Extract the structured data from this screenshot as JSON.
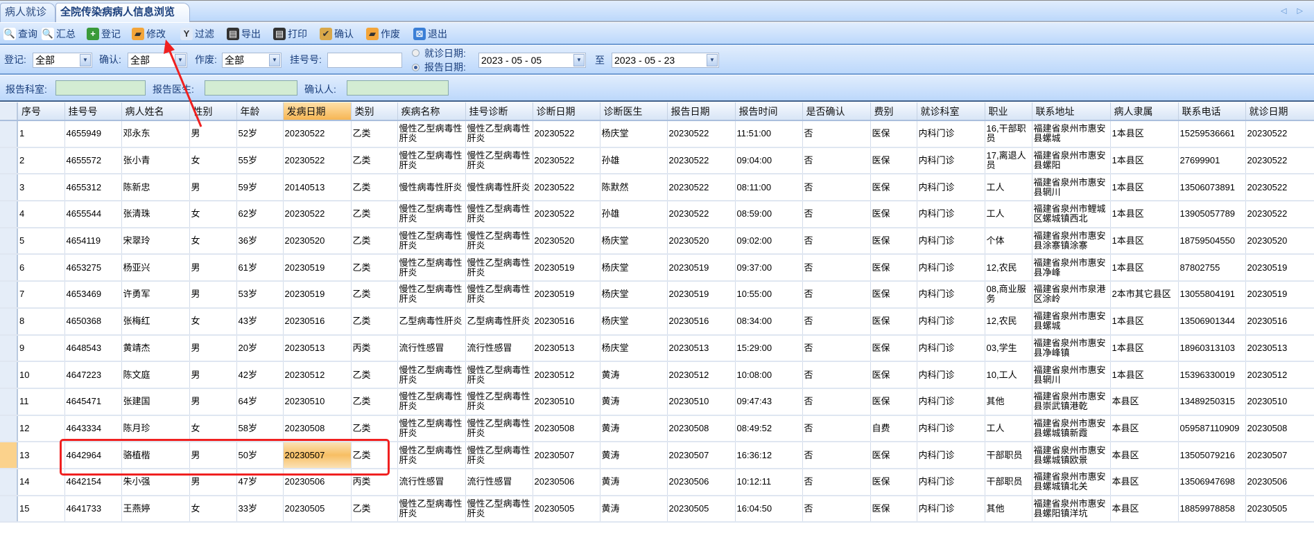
{
  "tabs": [
    "病人就诊",
    "全院传染病病人信息浏览"
  ],
  "nav_arrows": "◁ ▷",
  "toolbar": [
    {
      "label": "查询",
      "icon": "search-icon",
      "glyph": "🔍",
      "color": "#fff"
    },
    {
      "label": "汇总",
      "icon": "summary-icon",
      "glyph": "🔍",
      "color": "#fff"
    },
    {
      "label": "登记",
      "icon": "add-icon",
      "glyph": "+",
      "color": "#3a9a3a"
    },
    {
      "label": "修改",
      "icon": "edit-icon",
      "glyph": "▰",
      "color": "#f3a53a"
    },
    {
      "label": "过滤",
      "icon": "filter-icon",
      "glyph": "Y",
      "color": "#dfe9f7"
    },
    {
      "label": "导出",
      "icon": "export-icon",
      "glyph": "▤",
      "color": "#333"
    },
    {
      "label": "打印",
      "icon": "print-icon",
      "glyph": "▤",
      "color": "#333"
    },
    {
      "label": "确认",
      "icon": "confirm-icon",
      "glyph": "✔",
      "color": "#d9a84a"
    },
    {
      "label": "作废",
      "icon": "void-icon",
      "glyph": "▰",
      "color": "#f3a53a"
    },
    {
      "label": "退出",
      "icon": "exit-icon",
      "glyph": "⊠",
      "color": "#3b7fd6"
    }
  ],
  "filter": {
    "register_label": "登记:",
    "register_value": "全部",
    "confirm_label": "确认:",
    "confirm_value": "全部",
    "void_label": "作废:",
    "void_value": "全部",
    "regno_label": "挂号号:",
    "regno_value": "",
    "radio_visit": "就诊日期:",
    "radio_report": "报告日期:",
    "date_from": "2023 - 05 - 05",
    "to_label": "至",
    "date_to": "2023 - 05 - 23"
  },
  "report": {
    "dept_label": "报告科室:",
    "doctor_label": "报告医生:",
    "confirmer_label": "确认人:"
  },
  "grid": {
    "columns": [
      "序号",
      "挂号号",
      "病人姓名",
      "性别",
      "年龄",
      "发病日期",
      "类别",
      "疾病名称",
      "挂号诊断",
      "诊断日期",
      "诊断医生",
      "报告日期",
      "报告时间",
      "是否确认",
      "费别",
      "就诊科室",
      "职业",
      "联系地址",
      "病人隶属",
      "联系电话",
      "就诊日期"
    ],
    "selected_row": 13,
    "rows": [
      [
        "1",
        "4655949",
        "邓永东",
        "男",
        "52岁",
        "20230522",
        "乙类",
        "慢性乙型病毒性肝炎",
        "慢性乙型病毒性肝炎",
        "20230522",
        "杨庆堂",
        "20230522",
        "11:51:00",
        "否",
        "医保",
        "内科门诊",
        "16,干部职员",
        "福建省泉州市惠安县螺城",
        "1本县区",
        "15259536661",
        "20230522"
      ],
      [
        "2",
        "4655572",
        "张小青",
        "女",
        "55岁",
        "20230522",
        "乙类",
        "慢性乙型病毒性肝炎",
        "慢性乙型病毒性肝炎",
        "20230522",
        "孙雄",
        "20230522",
        "09:04:00",
        "否",
        "医保",
        "内科门诊",
        "17,离退人员",
        "福建省泉州市惠安县螺阳",
        "1本县区",
        "27699901",
        "20230522"
      ],
      [
        "3",
        "4655312",
        "陈新忠",
        "男",
        "59岁",
        "20140513",
        "乙类",
        "慢性病毒性肝炎",
        "慢性病毒性肝炎",
        "20230522",
        "陈默然",
        "20230522",
        "08:11:00",
        "否",
        "医保",
        "内科门诊",
        "工人",
        "福建省泉州市惠安县辋川",
        "1本县区",
        "13506073891",
        "20230522"
      ],
      [
        "4",
        "4655544",
        "张清珠",
        "女",
        "62岁",
        "20230522",
        "乙类",
        "慢性乙型病毒性肝炎",
        "慢性乙型病毒性肝炎",
        "20230522",
        "孙雄",
        "20230522",
        "08:59:00",
        "否",
        "医保",
        "内科门诊",
        "工人",
        "福建省泉州市鲤城区螺城镇西北",
        "1本县区",
        "13905057789",
        "20230522"
      ],
      [
        "5",
        "4654119",
        "宋翠玲",
        "女",
        "36岁",
        "20230520",
        "乙类",
        "慢性乙型病毒性肝炎",
        "慢性乙型病毒性肝炎",
        "20230520",
        "杨庆堂",
        "20230520",
        "09:02:00",
        "否",
        "医保",
        "内科门诊",
        "个体",
        "福建省泉州市惠安县涂寨镇涂寨",
        "1本县区",
        "18759504550",
        "20230520"
      ],
      [
        "6",
        "4653275",
        "杨亚兴",
        "男",
        "61岁",
        "20230519",
        "乙类",
        "慢性乙型病毒性肝炎",
        "慢性乙型病毒性肝炎",
        "20230519",
        "杨庆堂",
        "20230519",
        "09:37:00",
        "否",
        "医保",
        "内科门诊",
        "12,农民",
        "福建省泉州市惠安县净峰",
        "1本县区",
        "87802755",
        "20230519"
      ],
      [
        "7",
        "4653469",
        "许勇军",
        "男",
        "53岁",
        "20230519",
        "乙类",
        "慢性乙型病毒性肝炎",
        "慢性乙型病毒性肝炎",
        "20230519",
        "杨庆堂",
        "20230519",
        "10:55:00",
        "否",
        "医保",
        "内科门诊",
        "08,商业服务",
        "福建省泉州市泉港区涂岭",
        "2本市其它县区",
        "13055804191",
        "20230519"
      ],
      [
        "8",
        "4650368",
        "张梅红",
        "女",
        "43岁",
        "20230516",
        "乙类",
        "乙型病毒性肝炎",
        "乙型病毒性肝炎",
        "20230516",
        "杨庆堂",
        "20230516",
        "08:34:00",
        "否",
        "医保",
        "内科门诊",
        "12,农民",
        "福建省泉州市惠安县螺城",
        "1本县区",
        "13506901344",
        "20230516"
      ],
      [
        "9",
        "4648543",
        "黄靖杰",
        "男",
        "20岁",
        "20230513",
        "丙类",
        "流行性感冒",
        "流行性感冒",
        "20230513",
        "杨庆堂",
        "20230513",
        "15:29:00",
        "否",
        "医保",
        "内科门诊",
        "03,学生",
        "福建省泉州市惠安县净峰镇",
        "1本县区",
        "18960313103",
        "20230513"
      ],
      [
        "10",
        "4647223",
        "陈文庭",
        "男",
        "42岁",
        "20230512",
        "乙类",
        "慢性乙型病毒性肝炎",
        "慢性乙型病毒性肝炎",
        "20230512",
        "黄涛",
        "20230512",
        "10:08:00",
        "否",
        "医保",
        "内科门诊",
        "10,工人",
        "福建省泉州市惠安县辋川",
        "1本县区",
        "15396330019",
        "20230512"
      ],
      [
        "11",
        "4645471",
        "张建国",
        "男",
        "64岁",
        "20230510",
        "乙类",
        "慢性乙型病毒性肝炎",
        "慢性乙型病毒性肝炎",
        "20230510",
        "黄涛",
        "20230510",
        "09:47:43",
        "否",
        "医保",
        "内科门诊",
        "其他",
        "福建省泉州市惠安县崇武镇港乾",
        "本县区",
        "13489250315",
        "20230510"
      ],
      [
        "12",
        "4643334",
        "陈月珍",
        "女",
        "58岁",
        "20230508",
        "乙类",
        "慢性乙型病毒性肝炎",
        "慢性乙型病毒性肝炎",
        "20230508",
        "黄涛",
        "20230508",
        "08:49:52",
        "否",
        "自费",
        "内科门诊",
        "工人",
        "福建省泉州市惠安县螺城镇新霞",
        "本县区",
        "059587110909",
        "20230508"
      ],
      [
        "13",
        "4642964",
        "骆植楷",
        "男",
        "50岁",
        "20230507",
        "乙类",
        "慢性乙型病毒性肝炎",
        "慢性乙型病毒性肝炎",
        "20230507",
        "黄涛",
        "20230507",
        "16:36:12",
        "否",
        "医保",
        "内科门诊",
        "干部职员",
        "福建省泉州市惠安县螺城镇欧景",
        "本县区",
        "13505079216",
        "20230507"
      ],
      [
        "14",
        "4642154",
        "朱小强",
        "男",
        "47岁",
        "20230506",
        "丙类",
        "流行性感冒",
        "流行性感冒",
        "20230506",
        "黄涛",
        "20230506",
        "10:12:11",
        "否",
        "医保",
        "内科门诊",
        "干部职员",
        "福建省泉州市惠安县螺城镇北关",
        "本县区",
        "13506947698",
        "20230506"
      ],
      [
        "15",
        "4641733",
        "王燕婷",
        "女",
        "33岁",
        "20230505",
        "乙类",
        "慢性乙型病毒性肝炎",
        "慢性乙型病毒性肝炎",
        "20230505",
        "黄涛",
        "20230505",
        "16:04:50",
        "否",
        "医保",
        "内科门诊",
        "其他",
        "福建省泉州市惠安县螺阳镇洋坑",
        "本县区",
        "18859978858",
        "20230505"
      ]
    ]
  },
  "annotation_color": "#f02020"
}
